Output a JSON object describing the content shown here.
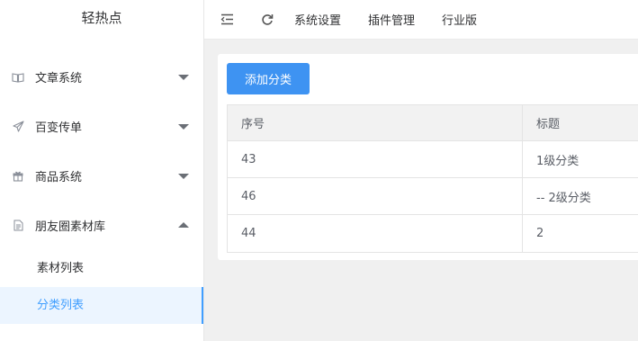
{
  "app": {
    "title": "轻热点"
  },
  "sidebar": {
    "menus": [
      {
        "label": "文章系统",
        "icon": "book-icon",
        "expanded": false
      },
      {
        "label": "百变传单",
        "icon": "send-icon",
        "expanded": false
      },
      {
        "label": "商品系统",
        "icon": "gift-icon",
        "expanded": false
      },
      {
        "label": "朋友圈素材库",
        "icon": "document-icon",
        "expanded": true
      }
    ],
    "submenu": [
      {
        "label": "素材列表",
        "active": false
      },
      {
        "label": "分类列表",
        "active": true
      }
    ]
  },
  "topbar": {
    "icons": [
      "fold-menu-icon",
      "refresh-icon"
    ],
    "links": [
      "系统设置",
      "插件管理",
      "行业版"
    ]
  },
  "main": {
    "add_button": "添加分类",
    "table": {
      "headers": [
        "序号",
        "标题"
      ],
      "rows": [
        [
          "43",
          "1级分类"
        ],
        [
          "46",
          "-- 2级分类"
        ],
        [
          "44",
          "2"
        ]
      ]
    }
  },
  "colors": {
    "accent": "#409eff",
    "button": "#3e93f2",
    "active_bg": "#ecf5ff"
  }
}
